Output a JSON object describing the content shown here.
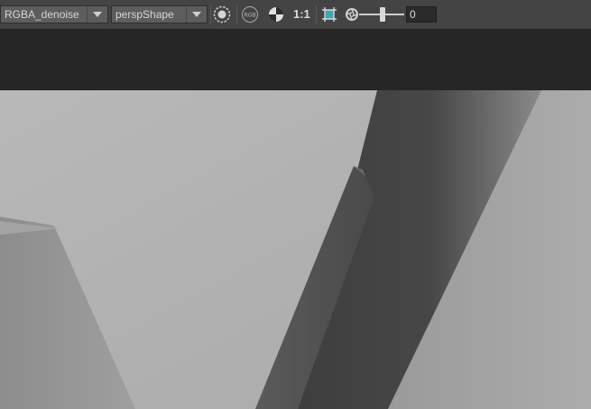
{
  "toolbar": {
    "channel_select": {
      "value": "RGBA_denoise"
    },
    "camera_select": {
      "value": "perspShape"
    },
    "ratio_label": "1:1",
    "exposure_value": "0"
  },
  "icons": [
    "snapshot-icon",
    "rgb-icon",
    "checker-icon",
    "region-icon",
    "aperture-icon",
    "chevron-down-icon"
  ]
}
